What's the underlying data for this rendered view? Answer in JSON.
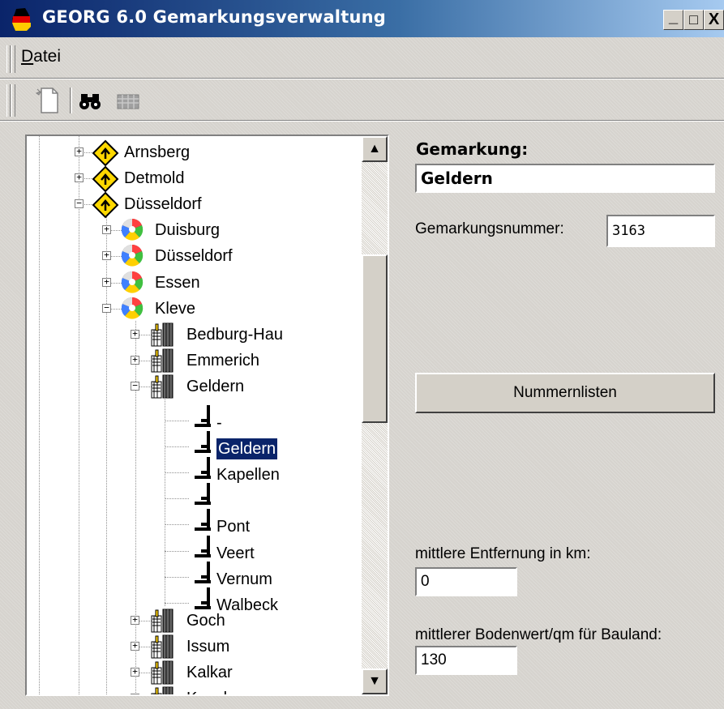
{
  "window": {
    "title": "GEORG 6.0 Gemarkungsverwaltung",
    "controls": {
      "minimize": "_",
      "maximize": "□",
      "close": "X"
    }
  },
  "menu": {
    "items": [
      {
        "label": "Datei",
        "mnemonic": "D",
        "rest": "atei"
      }
    ]
  },
  "toolbar": {
    "icons": [
      "new-document-icon",
      "binoculars-icon",
      "grid-icon"
    ]
  },
  "tree": {
    "nodes": [
      {
        "label": "Arnsberg",
        "icon": "regierungsbezirk-sign-icon",
        "expander": "+"
      },
      {
        "label": "Detmold",
        "icon": "regierungsbezirk-sign-icon",
        "expander": "+"
      },
      {
        "label": "Düsseldorf",
        "icon": "regierungsbezirk-sign-icon",
        "expander": "−"
      },
      {
        "label": "Duisburg",
        "icon": "kreis-ball-icon",
        "expander": "+"
      },
      {
        "label": "Düsseldorf",
        "icon": "kreis-ball-icon",
        "expander": "+"
      },
      {
        "label": "Essen",
        "icon": "kreis-ball-icon",
        "expander": "+"
      },
      {
        "label": "Kleve",
        "icon": "kreis-ball-icon",
        "expander": "−"
      },
      {
        "label": "Bedburg-Hau",
        "icon": "gemeinde-building-icon",
        "expander": "+"
      },
      {
        "label": "Emmerich",
        "icon": "gemeinde-building-icon",
        "expander": "+"
      },
      {
        "label": "Geldern",
        "icon": "gemeinde-building-icon",
        "expander": "−"
      },
      {
        "label": "-",
        "icon": "gemarkung-flag-icon",
        "expander": ""
      },
      {
        "label": "Geldern",
        "icon": "gemarkung-flag-icon",
        "expander": "",
        "selected": true
      },
      {
        "label": "Kapellen",
        "icon": "gemarkung-flag-icon",
        "expander": ""
      },
      {
        "label": "",
        "icon": "gemarkung-flag-icon",
        "expander": ""
      },
      {
        "label": "Pont",
        "icon": "gemarkung-flag-icon",
        "expander": ""
      },
      {
        "label": "Veert",
        "icon": "gemarkung-flag-icon",
        "expander": ""
      },
      {
        "label": "Vernum",
        "icon": "gemarkung-flag-icon",
        "expander": ""
      },
      {
        "label": "Walbeck",
        "icon": "gemarkung-flag-icon",
        "expander": ""
      },
      {
        "label": "Goch",
        "icon": "gemeinde-building-icon",
        "expander": "+"
      },
      {
        "label": "Issum",
        "icon": "gemeinde-building-icon",
        "expander": "+"
      },
      {
        "label": "Kalkar",
        "icon": "gemeinde-building-icon",
        "expander": "+"
      },
      {
        "label": "Kevelaer",
        "icon": "gemeinde-building-icon",
        "expander": "+"
      }
    ],
    "scrollbar": {
      "up": "▲",
      "down": "▼"
    }
  },
  "details": {
    "gemarkung_label": "Gemarkung:",
    "gemarkung_value": "Geldern",
    "nummer_label": "Gemarkungsnummer:",
    "nummer_value": "3163",
    "nummernlisten_button": "Nummernlisten",
    "entfernung_label": "mittlere Entfernung in km:",
    "entfernung_value": "0",
    "bodenwert_label": "mittlerer Bodenwert/qm für Bauland:",
    "bodenwert_value": "130"
  }
}
